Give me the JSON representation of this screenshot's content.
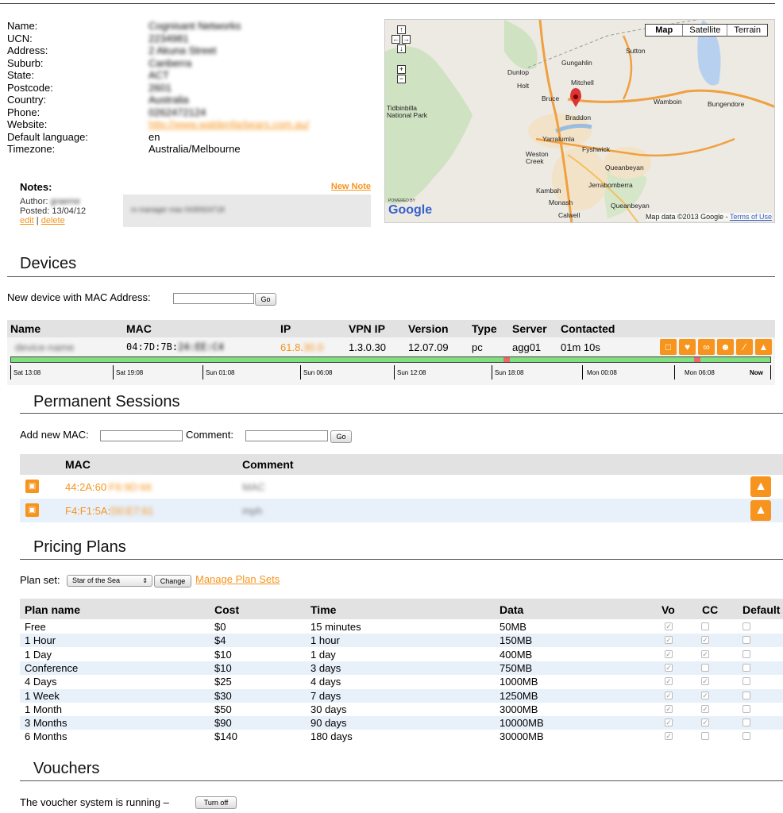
{
  "info": {
    "rows": [
      {
        "label": "Name:",
        "value": "Cognisant Networks",
        "blurred": true
      },
      {
        "label": "UCN:",
        "value": "2234981",
        "blurred": true
      },
      {
        "label": "Address:",
        "value": "2 Akuna Street",
        "blurred": true
      },
      {
        "label": "Suburb:",
        "value": "Canberra",
        "blurred": true
      },
      {
        "label": "State:",
        "value": "ACT",
        "blurred": true
      },
      {
        "label": "Postcode:",
        "value": "2601",
        "blurred": true
      },
      {
        "label": "Country:",
        "value": "Australia",
        "blurred": true
      },
      {
        "label": "Phone:",
        "value": "0262472124",
        "blurred": true
      },
      {
        "label": "Website:",
        "value": "http://www.waldenfarbears.com.au/",
        "blurred": true,
        "link": true
      },
      {
        "label": "Default language:",
        "value": "en",
        "blurred": false
      },
      {
        "label": "Timezone:",
        "value": "Australia/Melbourne",
        "blurred": false
      }
    ]
  },
  "notes": {
    "title": "Notes:",
    "new_note": "New Note",
    "author_label": "Author:",
    "author": "graeme",
    "posted": "Posted: 13/04/12",
    "edit": "edit",
    "sep": " | ",
    "delete": "delete",
    "text": "m manager max 0435924718"
  },
  "map": {
    "types": [
      "Map",
      "Satellite",
      "Terrain"
    ],
    "powered": "POWERED BY",
    "brand": "Google",
    "credit": "Map data ©2013 Google - ",
    "terms": "Terms of Use",
    "places": [
      "Sutton",
      "Gungahlin",
      "Dunlop",
      "Holt",
      "Mitchell",
      "Bruce",
      "Braddon",
      "Wamboin",
      "Bungendore",
      "Tidbinbilla National Park",
      "Yarralumla",
      "Fyshwick",
      "Weston Creek",
      "Queanbeyan",
      "Jerrabomberra",
      "Kambah",
      "Monash",
      "Calwell",
      "Queanbeyan"
    ]
  },
  "devices": {
    "heading": "Devices",
    "new_device_label": "New device with MAC Address:",
    "go": "Go",
    "headers": [
      "Name",
      "MAC",
      "IP",
      "VPN IP",
      "Version",
      "Type",
      "Server",
      "Contacted"
    ],
    "row": {
      "name": "device-name",
      "mac_visible": "04:7D:7B:",
      "mac_hidden": "24:EE:C4",
      "ip_visible": "61.8.",
      "ip_hidden": "30.0",
      "vpn_ip": "1.3.0.30",
      "version": "12.07.09",
      "type": "pc",
      "server": "agg01",
      "contacted": "01m 10s"
    },
    "timeline": [
      "Sat 13:08",
      "Sat 19:08",
      "Sun 01:08",
      "Sun 06:08",
      "Sun 12:08",
      "Sun 18:08",
      "Mon 00:08",
      "Mon 06:08",
      "Now"
    ]
  },
  "permanent_sessions": {
    "heading": "Permanent Sessions",
    "add_label": "Add new MAC:",
    "comment_label": "Comment:",
    "go": "Go",
    "headers": [
      "MAC",
      "Comment"
    ],
    "rows": [
      {
        "mac_visible": "44:2A:60",
        "mac_hidden": ":F6:9D:66",
        "comment": "MAC"
      },
      {
        "mac_visible": "F4:F1:5A:",
        "mac_hidden": "D0:E7:61",
        "comment": "mph"
      }
    ]
  },
  "pricing": {
    "heading": "Pricing Plans",
    "plan_set_label": "Plan set:",
    "plan_set_value": "Star of the Sea",
    "change": "Change",
    "manage": "Manage Plan Sets",
    "headers": [
      "Plan name",
      "Cost",
      "Time",
      "Data",
      "Vo",
      "CC",
      "Default"
    ],
    "rows": [
      {
        "name": "Free",
        "cost": "$0",
        "time": "15 minutes",
        "data": "50MB",
        "vo": true,
        "cc": false,
        "def": false
      },
      {
        "name": "1 Hour",
        "cost": "$4",
        "time": "1 hour",
        "data": "150MB",
        "vo": true,
        "cc": true,
        "def": false
      },
      {
        "name": "1 Day",
        "cost": "$10",
        "time": "1 day",
        "data": "400MB",
        "vo": true,
        "cc": true,
        "def": false
      },
      {
        "name": "Conference",
        "cost": "$10",
        "time": "3 days",
        "data": "750MB",
        "vo": true,
        "cc": false,
        "def": false
      },
      {
        "name": "4 Days",
        "cost": "$25",
        "time": "4 days",
        "data": "1000MB",
        "vo": true,
        "cc": true,
        "def": false
      },
      {
        "name": "1 Week",
        "cost": "$30",
        "time": "7 days",
        "data": "1250MB",
        "vo": true,
        "cc": true,
        "def": false
      },
      {
        "name": "1 Month",
        "cost": "$50",
        "time": "30 days",
        "data": "3000MB",
        "vo": true,
        "cc": true,
        "def": false
      },
      {
        "name": "3 Months",
        "cost": "$90",
        "time": "90 days",
        "data": "10000MB",
        "vo": true,
        "cc": true,
        "def": false
      },
      {
        "name": "6 Months",
        "cost": "$140",
        "time": "180 days",
        "data": "30000MB",
        "vo": true,
        "cc": false,
        "def": false
      }
    ]
  },
  "vouchers": {
    "heading": "Vouchers",
    "status": "The voucher system is running –",
    "turn_off": "Turn off"
  },
  "colors": {
    "accent": "#f7941d",
    "bar": "#7fe07f",
    "header_bg": "#e2e2e2",
    "alt_row": "#e8f0fa"
  },
  "icons": [
    "chat-icon",
    "heart-icon",
    "link-icon",
    "users-icon",
    "wrench-icon",
    "bank-icon",
    "edit-square-icon"
  ]
}
